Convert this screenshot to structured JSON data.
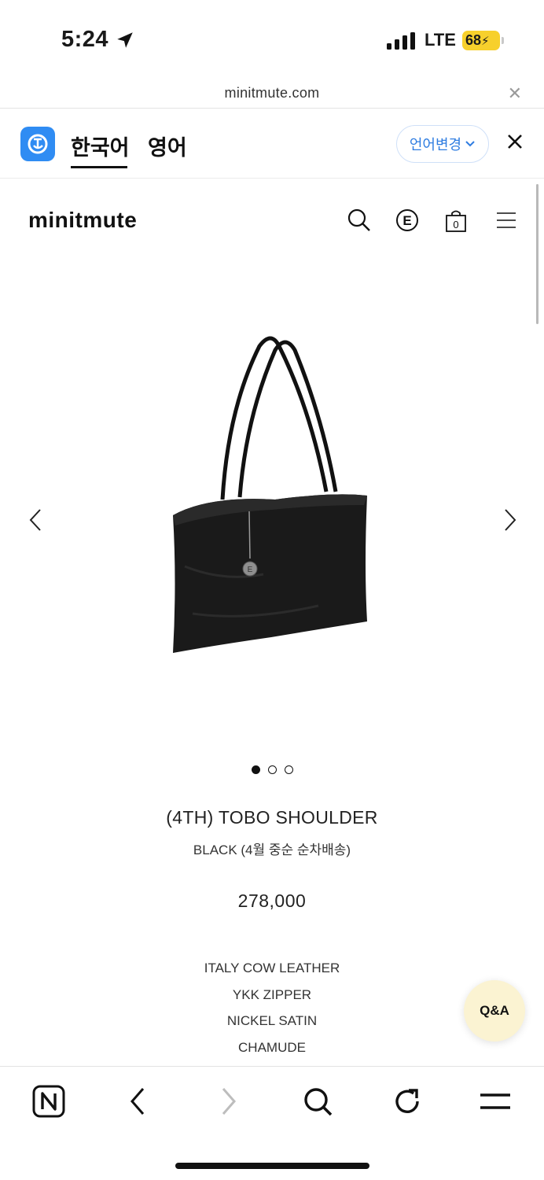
{
  "status_bar": {
    "time": "5:24",
    "network": "LTE",
    "battery": "68",
    "icons": [
      "location-arrow-icon",
      "signal-icon",
      "battery-charging-icon"
    ]
  },
  "browser": {
    "url": "minitmute.com",
    "toolbar_icons": [
      "naver-n-icon",
      "back-icon",
      "forward-icon",
      "search-icon",
      "reload-icon",
      "menu-icon"
    ]
  },
  "translate_bar": {
    "tabs": [
      {
        "label": "한국어",
        "active": true
      },
      {
        "label": "영어",
        "active": false
      }
    ],
    "change_language_label": "언어변경",
    "accent_color": "#2f8cf3"
  },
  "site": {
    "logo": "minitmute",
    "header_icons": [
      "search-icon",
      "e-icon",
      "shopping-bag-icon",
      "hamburger-menu-icon"
    ],
    "cart_count": "0"
  },
  "product": {
    "title": "(4TH) TOBO SHOULDER",
    "subtitle": "BLACK (4월 중순 순차배송)",
    "price": "278,000",
    "gallery": {
      "total": 3,
      "active": 1
    },
    "specs": [
      "ITALY COW LEATHER",
      "YKK ZIPPER",
      "NICKEL SATIN",
      "CHAMUDE"
    ]
  },
  "qa_button": "Q&A"
}
